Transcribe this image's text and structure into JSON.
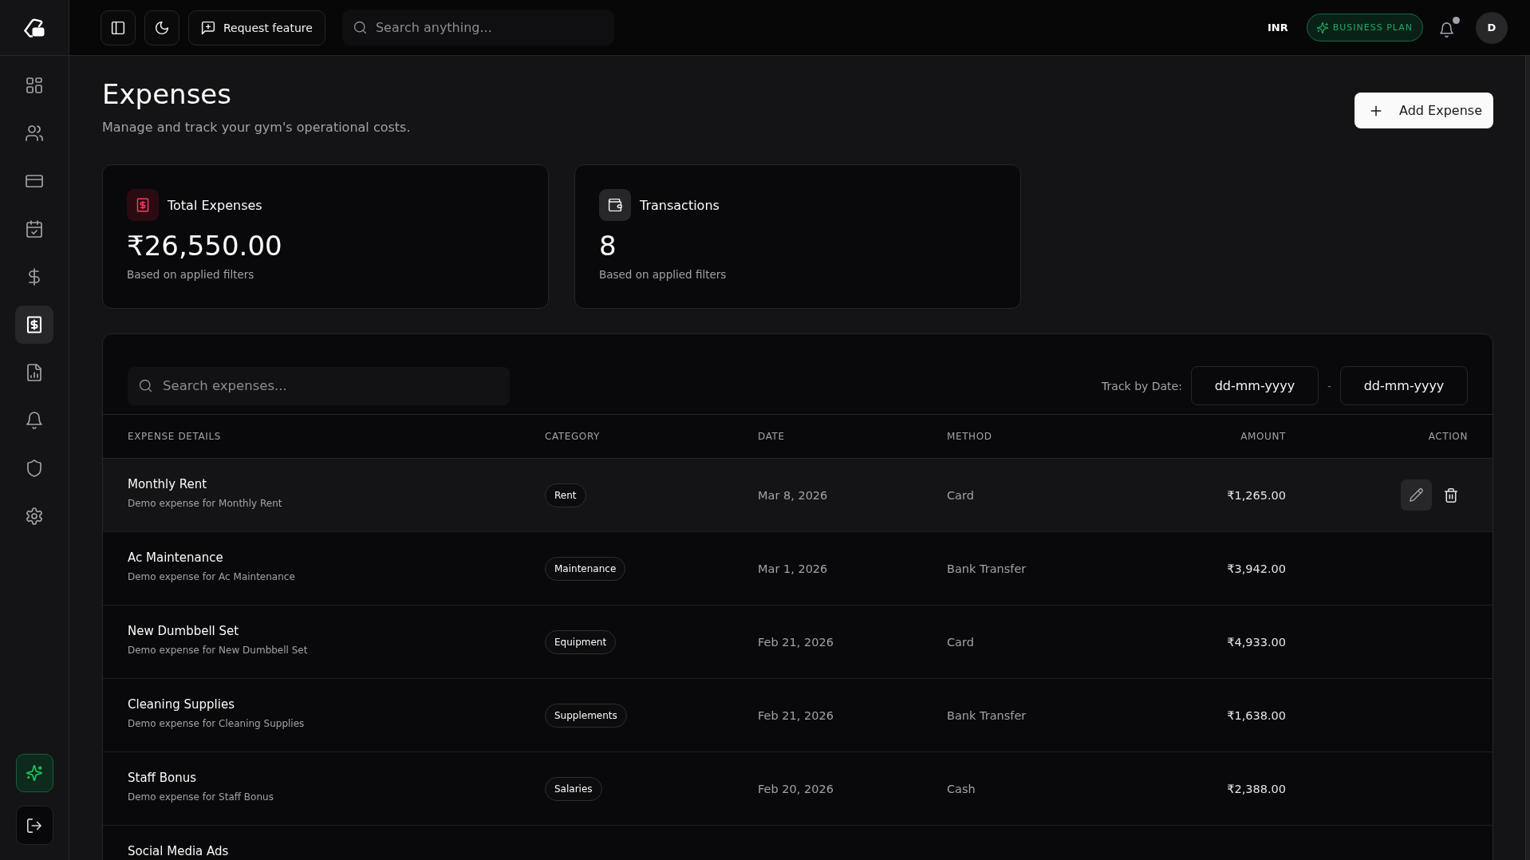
{
  "sidebar": {
    "items": [
      {
        "selected": false
      },
      {
        "selected": false
      },
      {
        "selected": false
      },
      {
        "selected": false
      },
      {
        "selected": false
      },
      {
        "selected": true
      },
      {
        "selected": false
      },
      {
        "selected": false
      },
      {
        "selected": false
      },
      {
        "selected": false
      }
    ]
  },
  "topbar": {
    "buttons": [
      {
        "kind": "sidebar-toggle"
      },
      {
        "kind": "theme"
      },
      {
        "kind": "request",
        "label": "Request feature"
      }
    ],
    "search": {
      "placeholder": "Search anything..."
    },
    "currency": "INR",
    "plan": "BUSINESS PLAN",
    "notifications": {
      "unread": true
    },
    "avatar": {
      "initial": "D"
    }
  },
  "page": {
    "title": "Expenses",
    "subtitle": "Manage and track your gym's operational costs.",
    "primary_button": "Add Expense"
  },
  "stats": [
    {
      "kind": "expense",
      "label": "Total Expenses",
      "value": "₹26,550.00",
      "note": "Based on applied filters"
    },
    {
      "kind": "count",
      "label": "Transactions",
      "value": "8",
      "note": "Based on applied filters"
    }
  ],
  "table": {
    "search": {
      "placeholder": "Search expenses..."
    },
    "date_filter": {
      "label": "Track by Date:",
      "from": {
        "placeholder": "dd-mm-yyyy"
      },
      "separator": "-",
      "to": {
        "placeholder": "dd-mm-yyyy"
      }
    },
    "columns": [
      "EXPENSE DETAILS",
      "CATEGORY",
      "DATE",
      "METHOD",
      "AMOUNT",
      "ACTION"
    ],
    "rows": [
      {
        "name": "Monthly Rent",
        "description": "Demo expense for Monthly Rent",
        "category": "Rent",
        "date": "Mar 8, 2026",
        "method": "Card",
        "amount": "₹1,265.00",
        "hovered": true
      },
      {
        "name": "Ac Maintenance",
        "description": "Demo expense for Ac Maintenance",
        "category": "Maintenance",
        "date": "Mar 1, 2026",
        "method": "Bank Transfer",
        "amount": "₹3,942.00",
        "hovered": false
      },
      {
        "name": "New Dumbbell Set",
        "description": "Demo expense for New Dumbbell Set",
        "category": "Equipment",
        "date": "Feb 21, 2026",
        "method": "Card",
        "amount": "₹4,933.00",
        "hovered": false
      },
      {
        "name": "Cleaning Supplies",
        "description": "Demo expense for Cleaning Supplies",
        "category": "Supplements",
        "date": "Feb 21, 2026",
        "method": "Bank Transfer",
        "amount": "₹1,638.00",
        "hovered": false
      },
      {
        "name": "Staff Bonus",
        "description": "Demo expense for Staff Bonus",
        "category": "Salaries",
        "date": "Feb 20, 2026",
        "method": "Cash",
        "amount": "₹2,388.00",
        "hovered": false
      },
      {
        "name": "Social Media Ads",
        "hovered": false
      }
    ]
  }
}
